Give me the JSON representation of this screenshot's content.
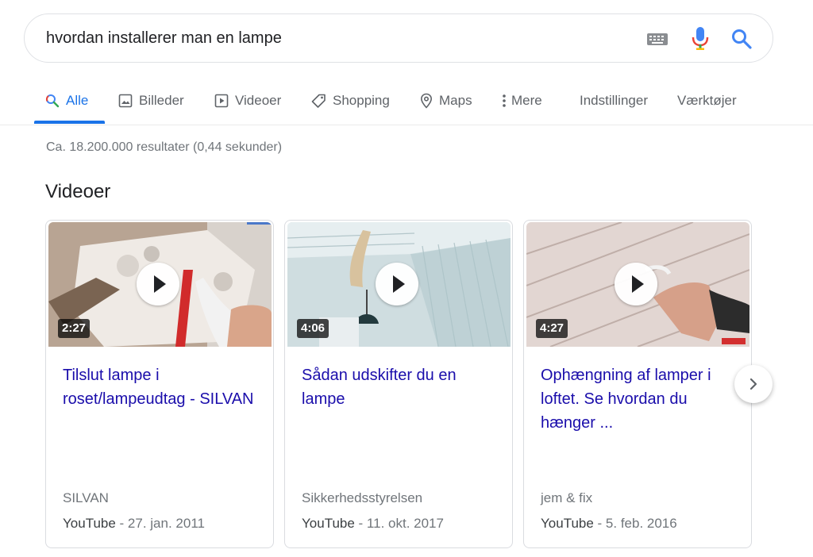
{
  "search": {
    "query": "hvordan installerer man en lampe",
    "keyboard_icon": "keyboard-icon",
    "mic_icon": "microphone-icon",
    "search_icon": "search-icon"
  },
  "tabs": [
    {
      "label": "Alle",
      "icon": "search-icon",
      "active": true
    },
    {
      "label": "Billeder",
      "icon": "image-icon"
    },
    {
      "label": "Videoer",
      "icon": "video-icon"
    },
    {
      "label": "Shopping",
      "icon": "tag-icon"
    },
    {
      "label": "Maps",
      "icon": "map-pin-icon"
    },
    {
      "label": "Mere",
      "icon": "more-vertical-icon"
    }
  ],
  "tools": {
    "settings": "Indstillinger",
    "tools": "Værktøjer"
  },
  "results_stats": "Ca. 18.200.000 resultater (0,44 sekunder)",
  "videos": {
    "section_title": "Videoer",
    "items": [
      {
        "title": "Tilslut lampe i roset/lampeudtag - SILVAN",
        "duration": "2:27",
        "channel": "SILVAN",
        "source": "YouTube",
        "date": " - 27. jan. 2011"
      },
      {
        "title": "Sådan udskifter du en lampe",
        "duration": "4:06",
        "channel": "Sikkerhedsstyrelsen",
        "source": "YouTube",
        "date": " - 11. okt. 2017"
      },
      {
        "title": "Ophængning af lamper i loftet. Se hvordan du hænger ...",
        "duration": "4:27",
        "channel": "jem & fix",
        "source": "YouTube",
        "date": " - 5. feb. 2016"
      }
    ],
    "next_icon": "chevron-right-icon"
  },
  "colors": {
    "link": "#1a0dab",
    "active_tab": "#1a73e8",
    "secondary_text": "#70757a"
  }
}
